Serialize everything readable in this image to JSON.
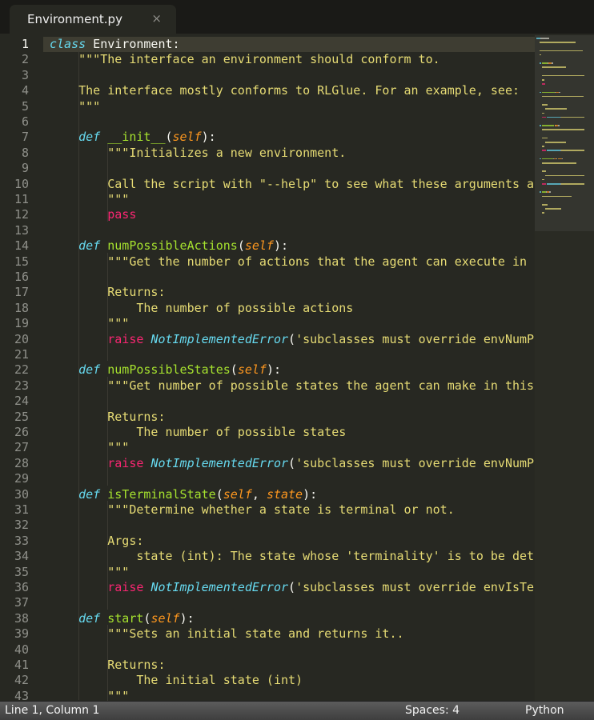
{
  "tab": {
    "title": "Environment.py",
    "close": "×"
  },
  "status": {
    "position": "Line 1, Column 1",
    "indentation": "Spaces: 4",
    "syntax": "Python"
  },
  "colors": {
    "keyword": "#66d9ef",
    "function": "#a6e22e",
    "parameter": "#fd971f",
    "string": "#e6db74",
    "control": "#f92672",
    "background": "#272822"
  },
  "current_line": 1,
  "lines": [
    {
      "n": "1",
      "parts": [
        {
          "t": "class",
          "c": "kw"
        },
        {
          "t": " Environment:",
          "c": ""
        }
      ]
    },
    {
      "n": "2",
      "parts": [
        {
          "t": "    \"\"\"The interface an environment should conform to.",
          "c": "str"
        }
      ]
    },
    {
      "n": "3",
      "parts": []
    },
    {
      "n": "4",
      "parts": [
        {
          "t": "    The interface mostly conforms to RLGlue. For an example, see:",
          "c": "str"
        }
      ]
    },
    {
      "n": "5",
      "parts": [
        {
          "t": "    \"\"\"",
          "c": "str"
        }
      ]
    },
    {
      "n": "6",
      "parts": []
    },
    {
      "n": "7",
      "parts": [
        {
          "t": "    ",
          "c": ""
        },
        {
          "t": "def",
          "c": "kw"
        },
        {
          "t": " ",
          "c": ""
        },
        {
          "t": "__init__",
          "c": "fn"
        },
        {
          "t": "(",
          "c": ""
        },
        {
          "t": "self",
          "c": "param"
        },
        {
          "t": "):",
          "c": ""
        }
      ]
    },
    {
      "n": "8",
      "parts": [
        {
          "t": "        \"\"\"Initializes a new environment.",
          "c": "str"
        }
      ]
    },
    {
      "n": "9",
      "parts": []
    },
    {
      "n": "10",
      "parts": [
        {
          "t": "        Call the script with \"--help\" to see what these arguments a",
          "c": "str"
        }
      ]
    },
    {
      "n": "11",
      "parts": [
        {
          "t": "        \"\"\"",
          "c": "str"
        }
      ]
    },
    {
      "n": "12",
      "parts": [
        {
          "t": "        ",
          "c": ""
        },
        {
          "t": "pass",
          "c": "pink"
        }
      ]
    },
    {
      "n": "13",
      "parts": []
    },
    {
      "n": "14",
      "parts": [
        {
          "t": "    ",
          "c": ""
        },
        {
          "t": "def",
          "c": "kw"
        },
        {
          "t": " ",
          "c": ""
        },
        {
          "t": "numPossibleActions",
          "c": "fn"
        },
        {
          "t": "(",
          "c": ""
        },
        {
          "t": "self",
          "c": "param"
        },
        {
          "t": "):",
          "c": ""
        }
      ]
    },
    {
      "n": "15",
      "parts": [
        {
          "t": "        \"\"\"Get the number of actions that the agent can execute in",
          "c": "str"
        }
      ]
    },
    {
      "n": "16",
      "parts": []
    },
    {
      "n": "17",
      "parts": [
        {
          "t": "        Returns:",
          "c": "str"
        }
      ]
    },
    {
      "n": "18",
      "parts": [
        {
          "t": "            The number of possible actions",
          "c": "str"
        }
      ]
    },
    {
      "n": "19",
      "parts": [
        {
          "t": "        \"\"\"",
          "c": "str"
        }
      ]
    },
    {
      "n": "20",
      "parts": [
        {
          "t": "        ",
          "c": ""
        },
        {
          "t": "raise",
          "c": "pink"
        },
        {
          "t": " ",
          "c": ""
        },
        {
          "t": "NotImplementedError",
          "c": "exc"
        },
        {
          "t": "(",
          "c": ""
        },
        {
          "t": "'subclasses must override envNumP",
          "c": "str"
        }
      ]
    },
    {
      "n": "21",
      "parts": []
    },
    {
      "n": "22",
      "parts": [
        {
          "t": "    ",
          "c": ""
        },
        {
          "t": "def",
          "c": "kw"
        },
        {
          "t": " ",
          "c": ""
        },
        {
          "t": "numPossibleStates",
          "c": "fn"
        },
        {
          "t": "(",
          "c": ""
        },
        {
          "t": "self",
          "c": "param"
        },
        {
          "t": "):",
          "c": ""
        }
      ]
    },
    {
      "n": "23",
      "parts": [
        {
          "t": "        \"\"\"Get number of possible states the agent can make in this",
          "c": "str"
        }
      ]
    },
    {
      "n": "24",
      "parts": []
    },
    {
      "n": "25",
      "parts": [
        {
          "t": "        Returns:",
          "c": "str"
        }
      ]
    },
    {
      "n": "26",
      "parts": [
        {
          "t": "            The number of possible states",
          "c": "str"
        }
      ]
    },
    {
      "n": "27",
      "parts": [
        {
          "t": "        \"\"\"",
          "c": "str"
        }
      ]
    },
    {
      "n": "28",
      "parts": [
        {
          "t": "        ",
          "c": ""
        },
        {
          "t": "raise",
          "c": "pink"
        },
        {
          "t": " ",
          "c": ""
        },
        {
          "t": "NotImplementedError",
          "c": "exc"
        },
        {
          "t": "(",
          "c": ""
        },
        {
          "t": "'subclasses must override envNumP",
          "c": "str"
        }
      ]
    },
    {
      "n": "29",
      "parts": []
    },
    {
      "n": "30",
      "parts": [
        {
          "t": "    ",
          "c": ""
        },
        {
          "t": "def",
          "c": "kw"
        },
        {
          "t": " ",
          "c": ""
        },
        {
          "t": "isTerminalState",
          "c": "fn"
        },
        {
          "t": "(",
          "c": ""
        },
        {
          "t": "self",
          "c": "param"
        },
        {
          "t": ", ",
          "c": ""
        },
        {
          "t": "state",
          "c": "param"
        },
        {
          "t": "):",
          "c": ""
        }
      ]
    },
    {
      "n": "31",
      "parts": [
        {
          "t": "        \"\"\"Determine whether a state is terminal or not.",
          "c": "str"
        }
      ]
    },
    {
      "n": "32",
      "parts": []
    },
    {
      "n": "33",
      "parts": [
        {
          "t": "        Args:",
          "c": "str"
        }
      ]
    },
    {
      "n": "34",
      "parts": [
        {
          "t": "            state (int): The state whose 'terminality' is to be det",
          "c": "str"
        }
      ]
    },
    {
      "n": "35",
      "parts": [
        {
          "t": "        \"\"\"",
          "c": "str"
        }
      ]
    },
    {
      "n": "36",
      "parts": [
        {
          "t": "        ",
          "c": ""
        },
        {
          "t": "raise",
          "c": "pink"
        },
        {
          "t": " ",
          "c": ""
        },
        {
          "t": "NotImplementedError",
          "c": "exc"
        },
        {
          "t": "(",
          "c": ""
        },
        {
          "t": "'subclasses must override envIsTe",
          "c": "str"
        }
      ]
    },
    {
      "n": "37",
      "parts": []
    },
    {
      "n": "38",
      "parts": [
        {
          "t": "    ",
          "c": ""
        },
        {
          "t": "def",
          "c": "kw"
        },
        {
          "t": " ",
          "c": ""
        },
        {
          "t": "start",
          "c": "fn"
        },
        {
          "t": "(",
          "c": ""
        },
        {
          "t": "self",
          "c": "param"
        },
        {
          "t": "):",
          "c": ""
        }
      ]
    },
    {
      "n": "39",
      "parts": [
        {
          "t": "        \"\"\"Sets an initial state and returns it..",
          "c": "str"
        }
      ]
    },
    {
      "n": "40",
      "parts": []
    },
    {
      "n": "41",
      "parts": [
        {
          "t": "        Returns:",
          "c": "str"
        }
      ]
    },
    {
      "n": "42",
      "parts": [
        {
          "t": "            The initial state (int)",
          "c": "str"
        }
      ]
    },
    {
      "n": "43",
      "parts": [
        {
          "t": "        \"\"\"",
          "c": "str"
        }
      ]
    }
  ]
}
